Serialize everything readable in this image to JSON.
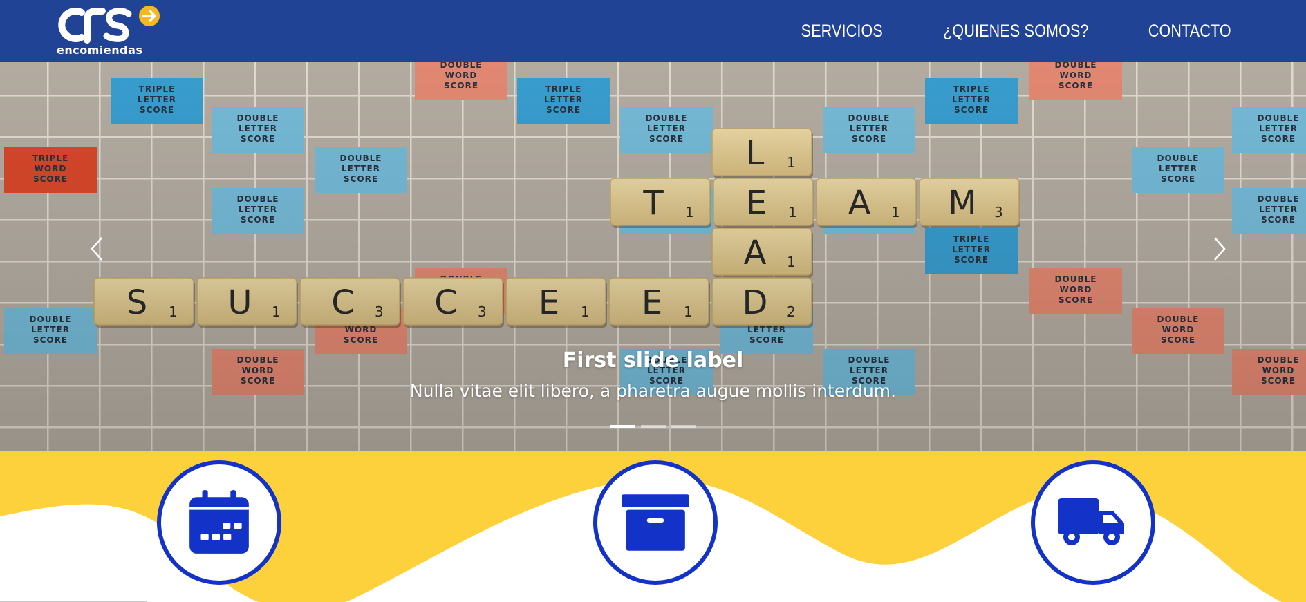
{
  "brand": {
    "logo_text": "CRS",
    "subtitle": "encomiendas",
    "colors": {
      "mark": "#ffffff",
      "accent_circle": "#f5b820"
    }
  },
  "nav": {
    "items": [
      {
        "label": "SERVICIOS"
      },
      {
        "label": "¿QUIENES SOMOS?"
      },
      {
        "label": "CONTACTO"
      }
    ],
    "background": "#214395"
  },
  "carousel": {
    "active_index": 0,
    "slide_count": 3,
    "slides": [
      {
        "title": "First slide label",
        "text": "Nulla vitae elit libero, a pharetra augue mollis interdum.",
        "image": "scrabble board with tiles spelling LEAD, TEAM and SUCCEED"
      }
    ],
    "board": {
      "premium_squares": {
        "triple_letter": "TRIPLE LETTER SCORE",
        "double_letter": "DOUBLE LETTER SCORE",
        "triple_word": "TRIPLE WORD SCORE",
        "double_word": "DOUBLE WORD SCORE"
      },
      "words": {
        "lead": {
          "letters": [
            "L",
            "E",
            "A",
            "D"
          ],
          "points": [
            1,
            1,
            1,
            2
          ]
        },
        "team": {
          "letters": [
            "T",
            "E",
            "A",
            "M"
          ],
          "points": [
            1,
            1,
            1,
            3
          ]
        },
        "succeed": {
          "letters": [
            "S",
            "U",
            "C",
            "C",
            "E",
            "E",
            "D"
          ],
          "points": [
            1,
            1,
            3,
            3,
            1,
            1,
            2
          ]
        }
      }
    },
    "controls": {
      "prev_icon": "chevron-left-icon",
      "next_icon": "chevron-right-icon"
    }
  },
  "features": {
    "items": [
      {
        "icon": "calendar-icon"
      },
      {
        "icon": "archive-box-icon"
      },
      {
        "icon": "delivery-truck-icon"
      }
    ],
    "colors": {
      "background": "#fdd13c",
      "wave": "#ffffff",
      "icon": "#1232c8"
    }
  }
}
